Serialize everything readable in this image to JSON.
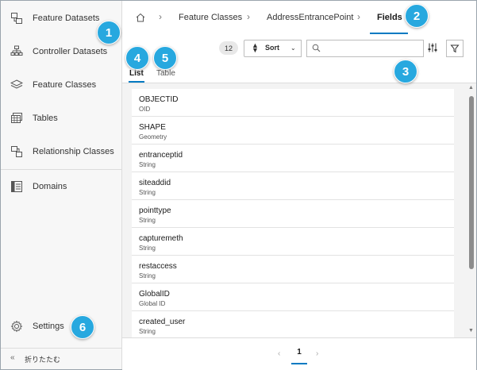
{
  "sidebar": {
    "items": [
      {
        "label": "Feature Datasets",
        "icon": "feature-datasets-icon"
      },
      {
        "label": "Controller Datasets",
        "icon": "controller-datasets-icon"
      },
      {
        "label": "Feature Classes",
        "icon": "feature-classes-icon"
      },
      {
        "label": "Tables",
        "icon": "tables-icon"
      },
      {
        "label": "Relationship Classes",
        "icon": "relationship-classes-icon"
      },
      {
        "label": "Domains",
        "icon": "domains-icon"
      }
    ],
    "settings_label": "Settings",
    "collapse_label": "折りたたむ",
    "collapse_icon": "«"
  },
  "breadcrumb": {
    "home_icon": "home-icon",
    "items": [
      "Feature Classes",
      "AddressEntrancePoint",
      "Fields"
    ],
    "separator": "›"
  },
  "toolbar": {
    "count": "12",
    "sort_label": "Sort",
    "search_placeholder": "",
    "search_value": ""
  },
  "tabs": [
    "List",
    "Table"
  ],
  "fields": [
    {
      "name": "OBJECTID",
      "type": "OID"
    },
    {
      "name": "SHAPE",
      "type": "Geometry"
    },
    {
      "name": "entranceptid",
      "type": "String"
    },
    {
      "name": "siteaddid",
      "type": "String"
    },
    {
      "name": "pointtype",
      "type": "String"
    },
    {
      "name": "capturemeth",
      "type": "String"
    },
    {
      "name": "restaccess",
      "type": "String"
    },
    {
      "name": "GlobalID",
      "type": "Global ID"
    },
    {
      "name": "created_user",
      "type": "String"
    }
  ],
  "pagination": {
    "current_page": "1",
    "prev": "‹",
    "next": "›"
  },
  "callouts": [
    "1",
    "2",
    "3",
    "4",
    "5",
    "6"
  ],
  "colors": {
    "accent": "#007ac2",
    "callout": "#27a8df"
  }
}
